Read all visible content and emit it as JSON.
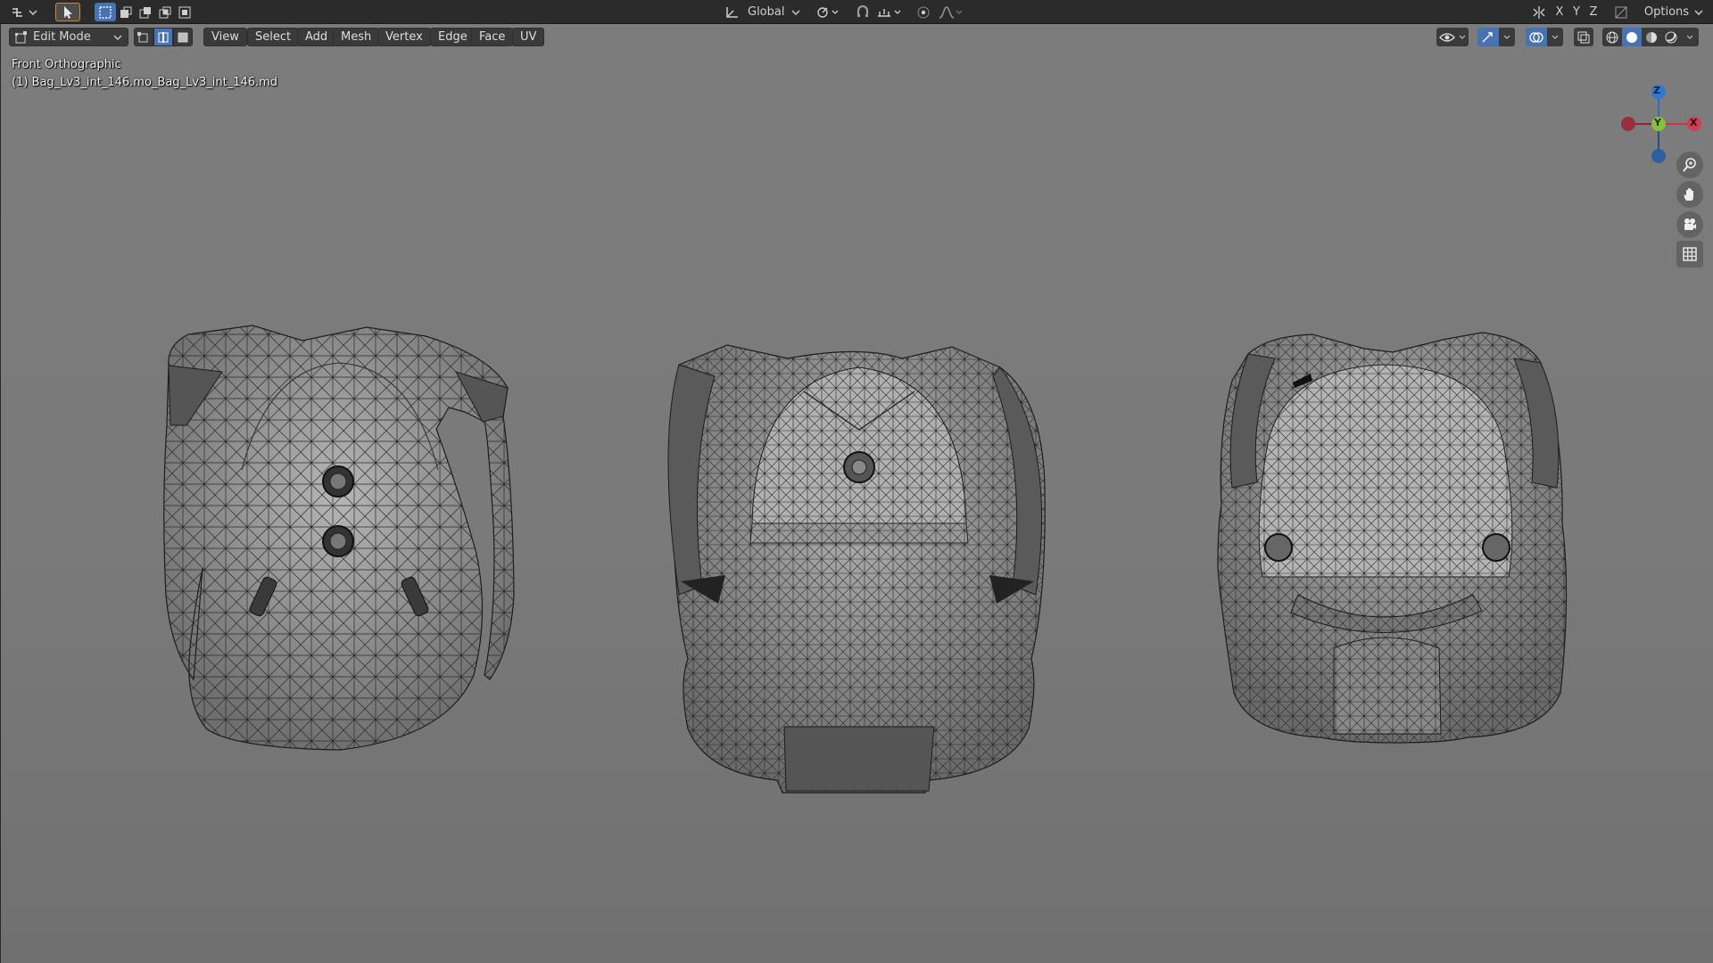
{
  "topbar": {
    "orientation": "Global",
    "axis_x": "X",
    "axis_y": "Y",
    "axis_z": "Z",
    "options": "Options"
  },
  "modebar": {
    "mode": "Edit Mode",
    "menus": [
      "View",
      "Select",
      "Add",
      "Mesh",
      "Vertex",
      "Edge",
      "Face",
      "UV"
    ]
  },
  "viewport": {
    "view_name": "Front Orthographic",
    "object_name": "(1) Bag_Lv3_int_146.mo_Bag_Lv3_int_146.md",
    "gizmo": {
      "z": "Z",
      "y": "Y",
      "x": "X"
    },
    "colors": {
      "x_axis": "#c9364d",
      "y_axis": "#76b82a",
      "z_axis": "#2b6fc7"
    }
  },
  "icons": [
    "editor-type-icon",
    "select-cursor-icon",
    "box-select-icon",
    "transform-pivot-icon",
    "snap-icon",
    "proportional-edit-icon",
    "mirror-icon",
    "overlay-icon",
    "xray-icon",
    "zoom-icon",
    "hand-pan-icon",
    "camera-icon",
    "grid-icon"
  ]
}
